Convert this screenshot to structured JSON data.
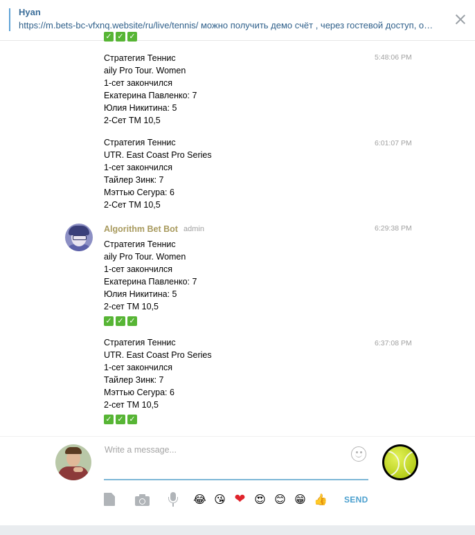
{
  "reply": {
    "name": "Hyan",
    "text": "https://m.bets-bc-vfxnq.website/ru/live/tennis/ можно получить демо счёт , через гостевой доступ, о…"
  },
  "peek_checks": [
    "✓",
    "✓",
    "✓"
  ],
  "messages": [
    {
      "time": "5:48:06 PM",
      "lines": [
        "Стратегия Теннис",
        "aily Pro Tour. Women",
        "1-сет закончился",
        "Екатерина Павленко:  7",
        "Юлия Никитина:  5",
        "2-Сет ТМ 10,5"
      ]
    },
    {
      "time": "6:01:07 PM",
      "lines": [
        "Стратегия Теннис",
        "UTR. East Coast Pro Series",
        "1-сет закончился",
        "Тайлер Зинк:  7",
        "Мэттью Сегура:  6",
        "2-Сет ТМ 10,5"
      ]
    },
    {
      "author": "Algorithm Bet Bot",
      "role": "admin",
      "time": "6:29:38 PM",
      "lines": [
        "Стратегия Теннис",
        "aily Pro Tour. Women",
        "1-сет закончился",
        "Екатерина Павленко:  7",
        "Юлия Никитина:  5",
        "2-сет ТМ 10,5"
      ],
      "checks": [
        "✓",
        "✓",
        "✓"
      ]
    },
    {
      "time": "6:37:08 PM",
      "lines": [
        "Стратегия Теннис",
        "UTR. East Coast Pro Series",
        "1-сет закончился",
        "Тайлер Зинк:  7",
        "Мэттью Сегура:  6",
        "2-сет ТМ 10,5"
      ],
      "checks": [
        "✓",
        "✓",
        "✓"
      ]
    }
  ],
  "composer": {
    "placeholder": "Write a message...",
    "send_label": "SEND",
    "icons": [
      "file-icon",
      "camera-icon",
      "microphone-icon"
    ],
    "quick_emoji": [
      {
        "name": "joy-emoji",
        "glyph": "😂"
      },
      {
        "name": "kiss-emoji",
        "glyph": "😘"
      },
      {
        "name": "heart-emoji",
        "glyph": "❤"
      },
      {
        "name": "heart-eyes-emoji",
        "glyph": "😍"
      },
      {
        "name": "smile-emoji",
        "glyph": "😊"
      },
      {
        "name": "grin-emoji",
        "glyph": "😁"
      },
      {
        "name": "thumbs-up-emoji",
        "glyph": "👍"
      }
    ]
  },
  "colors": {
    "accent": "#4a9fce",
    "author": "#a89a5e",
    "check": "#57b535",
    "time": "#a0a0a0"
  }
}
